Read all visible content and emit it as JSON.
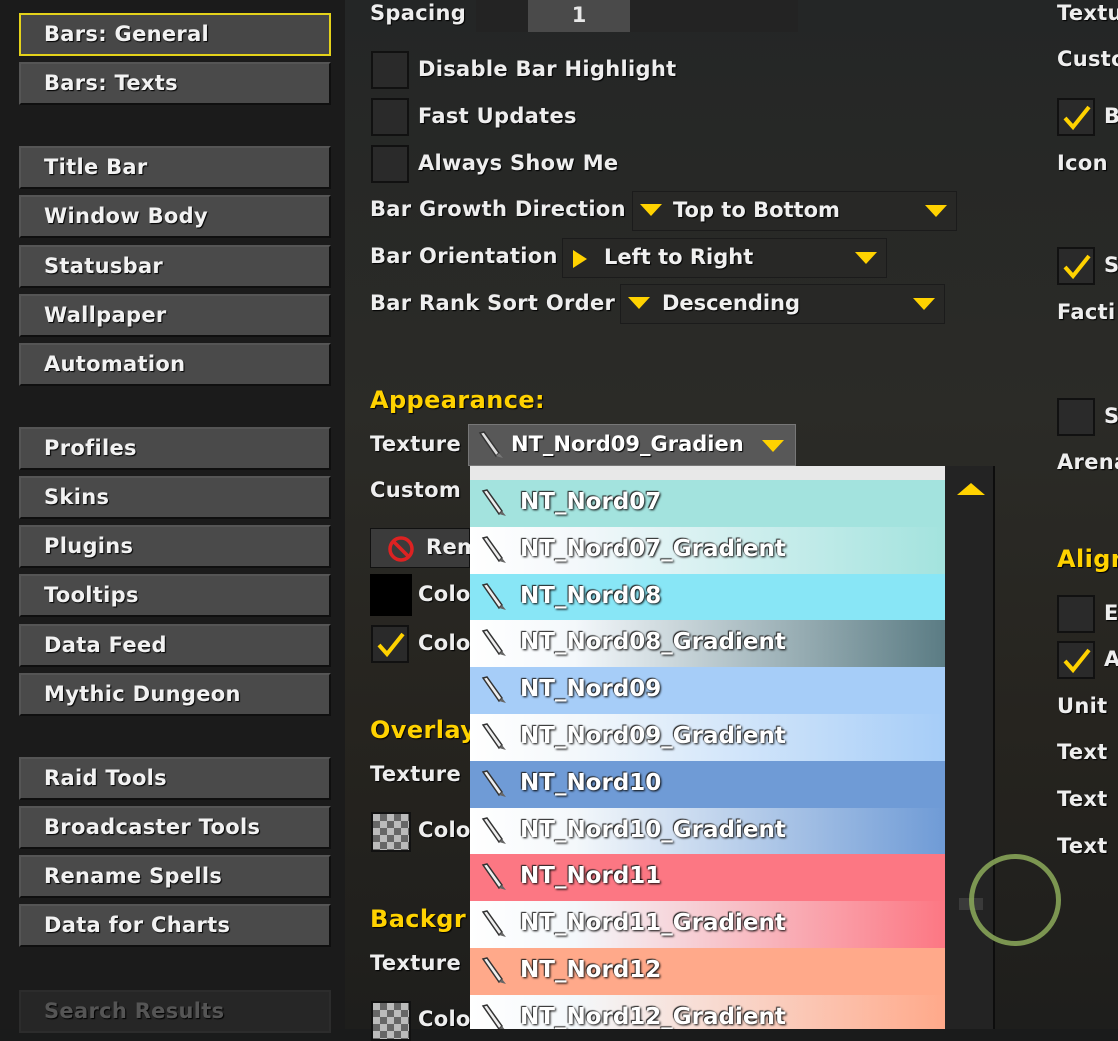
{
  "sidebar": {
    "items": [
      "Bars: General",
      "Bars: Texts",
      "Title Bar",
      "Window Body",
      "Statusbar",
      "Wallpaper",
      "Automation",
      "Profiles",
      "Skins",
      "Plugins",
      "Tooltips",
      "Data Feed",
      "Mythic Dungeon",
      "Raid Tools",
      "Broadcaster Tools",
      "Rename Spells",
      "Data for Charts"
    ],
    "selected": "Bars: General",
    "search_results": "Search Results"
  },
  "options": {
    "spacing_label": "Spacing",
    "spacing_value": "1",
    "disable_bar_highlight": "Disable Bar Highlight",
    "fast_updates": "Fast Updates",
    "always_show_me": "Always Show Me",
    "bar_growth_label": "Bar Growth Direction",
    "bar_growth_value": "Top to Bottom",
    "bar_orientation_label": "Bar Orientation",
    "bar_orientation_value": "Left to Right",
    "bar_rank_label": "Bar Rank Sort Order",
    "bar_rank_value": "Descending"
  },
  "appearance": {
    "header": "Appearance:",
    "texture_label": "Texture",
    "texture_value": "NT_Nord09_Gradien",
    "custom_label": "Custom",
    "remove_label": "Rem",
    "color1_label": "Colo",
    "color2_label": "Colo"
  },
  "overlay": {
    "header": "Overlay",
    "texture_label": "Texture",
    "color_label": "Colo"
  },
  "background": {
    "header": "Backgr",
    "texture_label": "Texture",
    "color_label": "Colo"
  },
  "texture_list": [
    {
      "name": "NT_Nord07",
      "color": "#a3e3de",
      "gradient": false
    },
    {
      "name": "NT_Nord07_Gradient",
      "color": "#a3e3de",
      "gradient": true
    },
    {
      "name": "NT_Nord08",
      "color": "#88e6f6",
      "gradient": false
    },
    {
      "name": "NT_Nord08_Gradient",
      "color": "#88e6f6",
      "gradient": true,
      "end": "#5b7c84"
    },
    {
      "name": "NT_Nord09",
      "color": "#a6cdf8",
      "gradient": false
    },
    {
      "name": "NT_Nord09_Gradient",
      "color": "#a6cdf8",
      "gradient": true
    },
    {
      "name": "NT_Nord10",
      "color": "#6f9bd6",
      "gradient": false
    },
    {
      "name": "NT_Nord10_Gradient",
      "color": "#6f9bd6",
      "gradient": true
    },
    {
      "name": "NT_Nord11",
      "color": "#fc7783",
      "gradient": false
    },
    {
      "name": "NT_Nord11_Gradient",
      "color": "#fc7783",
      "gradient": true
    },
    {
      "name": "NT_Nord12",
      "color": "#ffa98a",
      "gradient": false
    },
    {
      "name": "NT_Nord12_Gradient",
      "color": "#ffa98a",
      "gradient": true
    }
  ],
  "right_column": {
    "texture": "Textu",
    "custom": "Custo",
    "checkbox1": "B",
    "icon": "Icon",
    "checkbox2": "S",
    "faction": "Facti",
    "checkbox3": "S",
    "arena": "Arena",
    "align_header": "Align",
    "checkbox4": "E",
    "checkbox5": "A",
    "unit": "Unit",
    "text1": "Text",
    "text2": "Text",
    "text3": "Text"
  },
  "colors": {
    "accent": "#ffd200",
    "selected_border": "#e4d21a"
  }
}
